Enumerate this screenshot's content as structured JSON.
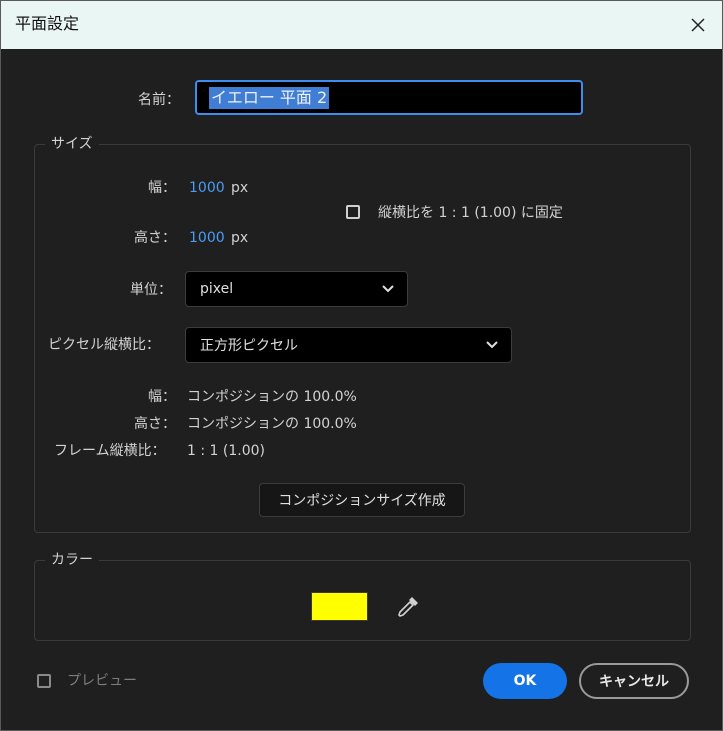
{
  "window": {
    "title": "平面設定",
    "close_icon": "close-icon"
  },
  "name": {
    "label": "名前：",
    "value": "イエロー 平面 2"
  },
  "size": {
    "group_title": "サイズ",
    "width_label": "幅：",
    "width_value": "1000",
    "width_unit": "px",
    "height_label": "高さ：",
    "height_value": "1000",
    "height_unit": "px",
    "lock_aspect_label": "縦横比を 1 : 1 (1.00) に固定",
    "lock_aspect_checked": false,
    "unit_label": "単位：",
    "unit_value": "pixel",
    "pixel_aspect_label": "ピクセル縦横比：",
    "pixel_aspect_value": "正方形ピクセル",
    "info": {
      "width_label": "幅：",
      "width_value": "コンポジションの 100.0%",
      "height_label": "高さ：",
      "height_value": "コンポジションの 100.0%",
      "frame_aspect_label": "フレーム縦横比：",
      "frame_aspect_value": "1 : 1 (1.00)"
    },
    "make_comp_size_button": "コンポジションサイズ作成"
  },
  "color": {
    "group_title": "カラー",
    "swatch_color": "#ffff00",
    "eyedropper_icon": "eyedropper-icon"
  },
  "footer": {
    "preview_label": "プレビュー",
    "preview_checked": false,
    "ok_label": "OK",
    "cancel_label": "キャンセル"
  },
  "colors": {
    "accent": "#1473e6",
    "value_blue": "#4a9cf6",
    "background": "#1f1f1f",
    "titlebar": "#eaf6f4"
  }
}
